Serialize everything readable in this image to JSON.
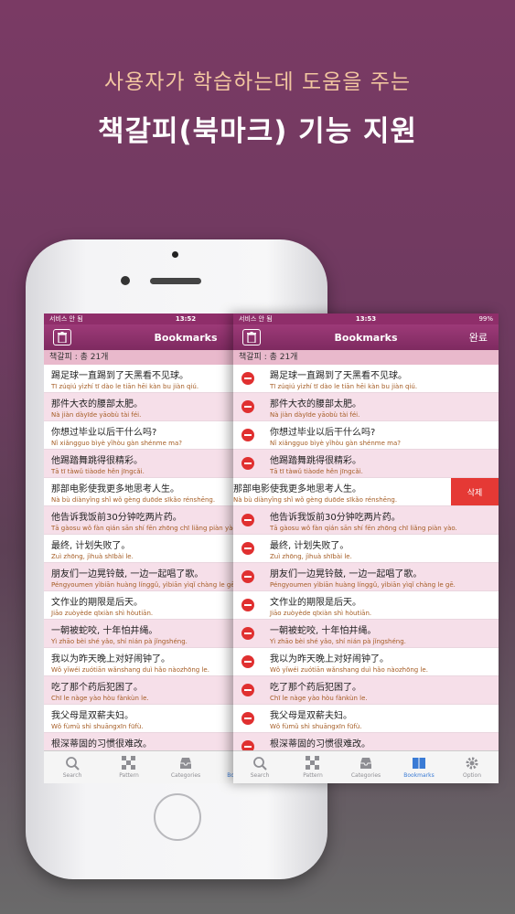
{
  "hero": {
    "line1": "사용자가 학습하는데 도움을 주는",
    "line2": "책갈피(북마크) 기능 지원"
  },
  "screen_left": {
    "status": {
      "carrier": "서비스 안 됨",
      "time": "13:52"
    },
    "nav_title": "Bookmarks",
    "count_label": "책갈피 : 총 21개"
  },
  "screen_right": {
    "status": {
      "carrier": "서비스 안 됨",
      "time": "13:53",
      "battery": "99%"
    },
    "nav_title": "Bookmarks",
    "done_label": "완료",
    "count_label": "책갈피 : 총 21개",
    "delete_label": "삭제"
  },
  "rows": [
    {
      "zh": "踢足球一直踢到了天黑看不见球。",
      "py": "Tī zúqiú yìzhí tī dào le tiān hēi kàn bu jiàn qiú."
    },
    {
      "zh": "那件大衣的腰部太肥。",
      "py": "Nà jiàn dàyīde yāobù tài féi."
    },
    {
      "zh": "你想过毕业以后干什么吗?",
      "py": "Nǐ xiǎngguo bìyè yǐhòu gàn shénme ma?"
    },
    {
      "zh": "他踢踏舞跳得很精彩。",
      "py": "Tā tī tàwǔ tiàode hěn jīngcǎi."
    },
    {
      "zh": "那部电影使我更多地思考人生。",
      "py": "Nà bù diànyǐng shǐ wǒ gèng duōde sīkǎo rénshēng."
    },
    {
      "zh": "他告诉我饭前30分钟吃两片药。",
      "py": "Tā gàosu wǒ fàn qián sān shí fēn zhōng chī liǎng piàn yào."
    },
    {
      "zh": "最终, 计划失败了。",
      "py": "Zuì zhōng, jìhuà shībài le."
    },
    {
      "zh": "朋友们一边晃铃鼓, 一边一起唱了歌。",
      "py": "Péngyoumen yìbiān huàng línggǔ, yìbiān yìqǐ chàng le gē."
    },
    {
      "zh": "文作业的期限是后天。",
      "py": "Jiāo zuòyède qīxiàn shì hòutiān."
    },
    {
      "zh": "一朝被蛇咬, 十年怕井绳。",
      "py": "Yì zhāo bèi shé yǎo, shí nián pà jǐngshéng."
    },
    {
      "zh": "我以为昨天晚上对好闹钟了。",
      "py": "Wǒ yǐwéi zuótiān wǎnshang duì hǎo nàozhōng le."
    },
    {
      "zh": "吃了那个药后犯困了。",
      "py": "Chī le nàge yào hòu fànkùn le."
    },
    {
      "zh": "我父母是双薪夫妇。",
      "py": "Wǒ fùmǔ shì shuāngxīn fūfù."
    },
    {
      "zh": "根深蒂固的习惯很难改。",
      "py": ""
    }
  ],
  "tabs": [
    {
      "label": "Search",
      "icon": "search-icon"
    },
    {
      "label": "Pattern",
      "icon": "grid-icon"
    },
    {
      "label": "Categories",
      "icon": "inbox-icon"
    },
    {
      "label": "Bookmarks",
      "icon": "book-icon"
    },
    {
      "label": "Option",
      "icon": "gear-icon"
    }
  ],
  "colors": {
    "accent": "#8f2e6a",
    "row_alt": "#f6dfe9",
    "pinyin": "#a55c24",
    "delete": "#e53935",
    "tab_active": "#3a7bd5"
  }
}
